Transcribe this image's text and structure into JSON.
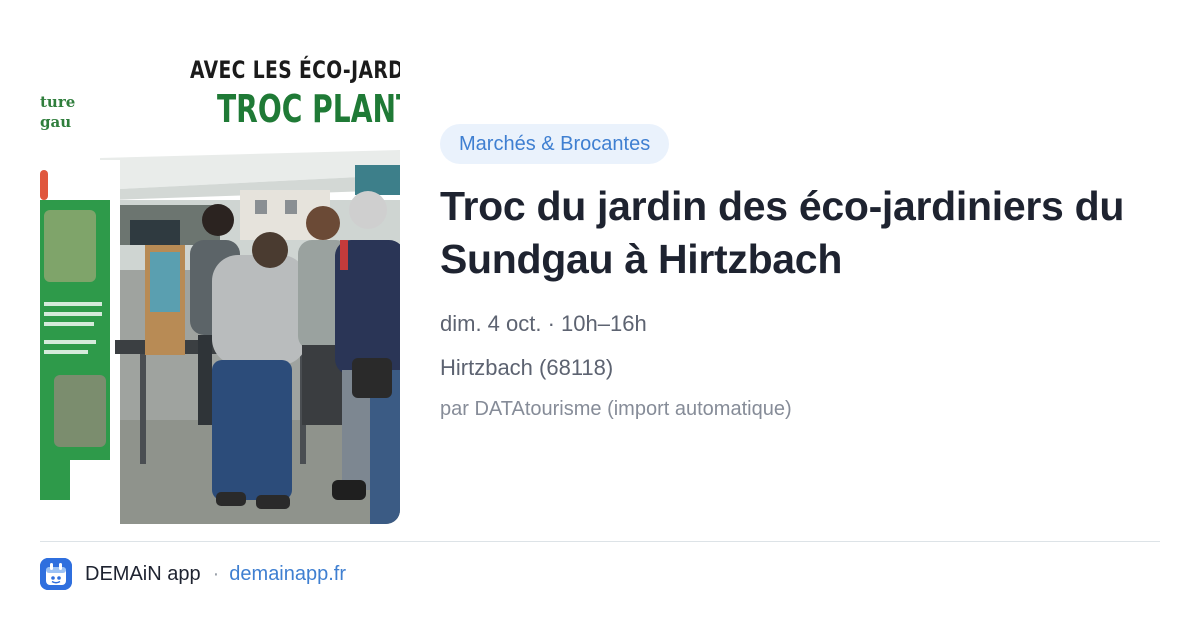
{
  "event": {
    "category": "Marchés & Brocantes",
    "title": "Troc du jardin des éco-jardiniers du Sundgau à Hirtzbach",
    "date_time": "dim. 4 oct. · 10h–16h",
    "location": "Hirtzbach (68118)",
    "source": "par DATAtourisme (import automatique)"
  },
  "photo": {
    "poster_line1": "AVEC LES ÉCO-JARDIN",
    "poster_line2": "TROC PLANTES",
    "poster_side": [
      "ture",
      "gau"
    ]
  },
  "footer": {
    "app_name": "DEMAiN app",
    "separator": "·",
    "domain": "demainapp.fr"
  },
  "colors": {
    "accent": "#3f7fd1",
    "chip_background": "#eaf2fc",
    "poster_green": "#1f7a36",
    "app_icon": "#2f6fde"
  },
  "icons": {
    "app": "demain-app-icon"
  }
}
